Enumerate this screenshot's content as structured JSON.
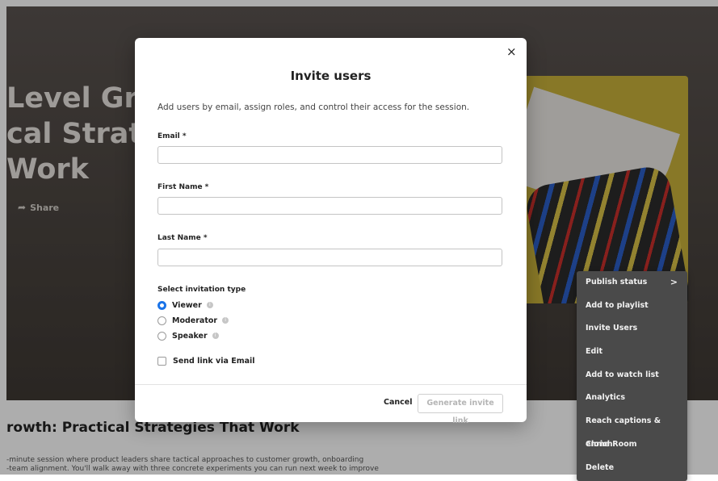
{
  "hero": {
    "title": "Level Grow\ncal Strateg\nWork",
    "share_label": "Share"
  },
  "content": {
    "title": "rowth: Practical Strategies That Work",
    "description": "-minute session where product leaders share tactical approaches to customer growth, onboarding\n-team alignment. You'll walk away with three concrete experiments you can run next week to improve"
  },
  "context_menu": {
    "items": [
      {
        "label": "Publish status",
        "has_submenu": true,
        "chevron": ">"
      },
      {
        "label": "Add to playlist"
      },
      {
        "label": "Invite Users"
      },
      {
        "label": "Edit"
      },
      {
        "label": "Add to watch list"
      },
      {
        "label": "Analytics"
      },
      {
        "label": "Reach captions & enrich"
      },
      {
        "label": "Clone Room"
      },
      {
        "label": "Delete"
      }
    ]
  },
  "modal": {
    "close_glyph": "×",
    "title": "Invite users",
    "subtitle": "Add users by email, assign roles, and control their access for the session.",
    "email_label": "Email *",
    "email_value": "",
    "first_name_label": "First Name *",
    "first_name_value": "",
    "last_name_label": "Last Name *",
    "last_name_value": "",
    "invitation_type_label": "Select invitation type",
    "invitation_types": [
      {
        "label": "Viewer",
        "selected": true
      },
      {
        "label": "Moderator",
        "selected": false
      },
      {
        "label": "Speaker",
        "selected": false
      }
    ],
    "send_email_label": "Send link via Email",
    "send_email_checked": false,
    "cancel_label": "Cancel",
    "generate_label": "Generate invite link"
  },
  "colors": {
    "accent": "#1a73e8",
    "menu_bg": "#4a4a4a"
  }
}
